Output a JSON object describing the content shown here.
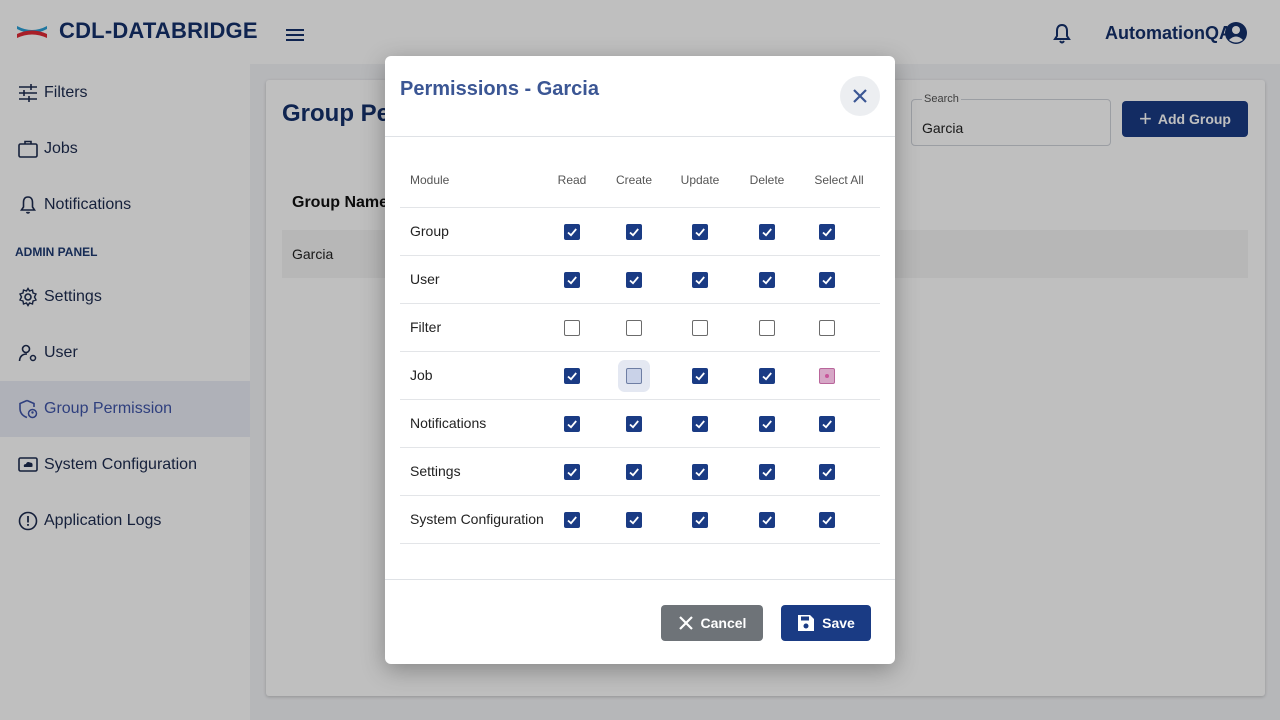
{
  "app": {
    "brand": "CDL-DATABRIDGE",
    "user": "AutomationQA"
  },
  "sidebar": {
    "items": [
      {
        "label": "Filters",
        "icon": "sliders-icon"
      },
      {
        "label": "Jobs",
        "icon": "briefcase-icon"
      },
      {
        "label": "Notifications",
        "icon": "bell-icon"
      },
      {
        "label": "Settings",
        "icon": "gear-icon"
      },
      {
        "label": "User",
        "icon": "user-gear-icon"
      },
      {
        "label": "Group Permission",
        "icon": "shield-user-icon",
        "active": true
      },
      {
        "label": "System Configuration",
        "icon": "monitor-cloud-icon"
      },
      {
        "label": "Application Logs",
        "icon": "alert-circle-icon"
      }
    ],
    "admin_label": "ADMIN PANEL"
  },
  "page": {
    "title": "Group Permission",
    "search_label": "Search",
    "search_value": "Garcia",
    "add_group_label": "Add Group",
    "table_header": "Group Name",
    "rows": [
      "Garcia"
    ]
  },
  "modal": {
    "title": "Permissions - Garcia",
    "columns": [
      "Module",
      "Read",
      "Create",
      "Update",
      "Delete",
      "Select All"
    ],
    "rows": [
      {
        "module": "Group",
        "states": [
          "checked",
          "checked",
          "checked",
          "checked",
          "checked"
        ]
      },
      {
        "module": "User",
        "states": [
          "checked",
          "checked",
          "checked",
          "checked",
          "checked"
        ]
      },
      {
        "module": "Filter",
        "states": [
          "unchecked",
          "unchecked",
          "unchecked",
          "unchecked",
          "unchecked"
        ]
      },
      {
        "module": "Job",
        "states": [
          "checked",
          "unchecked-focused",
          "checked",
          "checked",
          "indeterminate"
        ]
      },
      {
        "module": "Notifications",
        "states": [
          "checked",
          "checked",
          "checked",
          "checked",
          "checked"
        ]
      },
      {
        "module": "Settings",
        "states": [
          "checked",
          "checked",
          "checked",
          "checked",
          "checked"
        ]
      },
      {
        "module": "System Configuration",
        "states": [
          "checked",
          "checked",
          "checked",
          "checked",
          "checked"
        ]
      }
    ],
    "cancel_label": "Cancel",
    "save_label": "Save"
  },
  "colors": {
    "primary": "#1a3b84",
    "title": "#3b5694",
    "cancel": "#6e7378",
    "indeterminate": "#c8559a"
  }
}
